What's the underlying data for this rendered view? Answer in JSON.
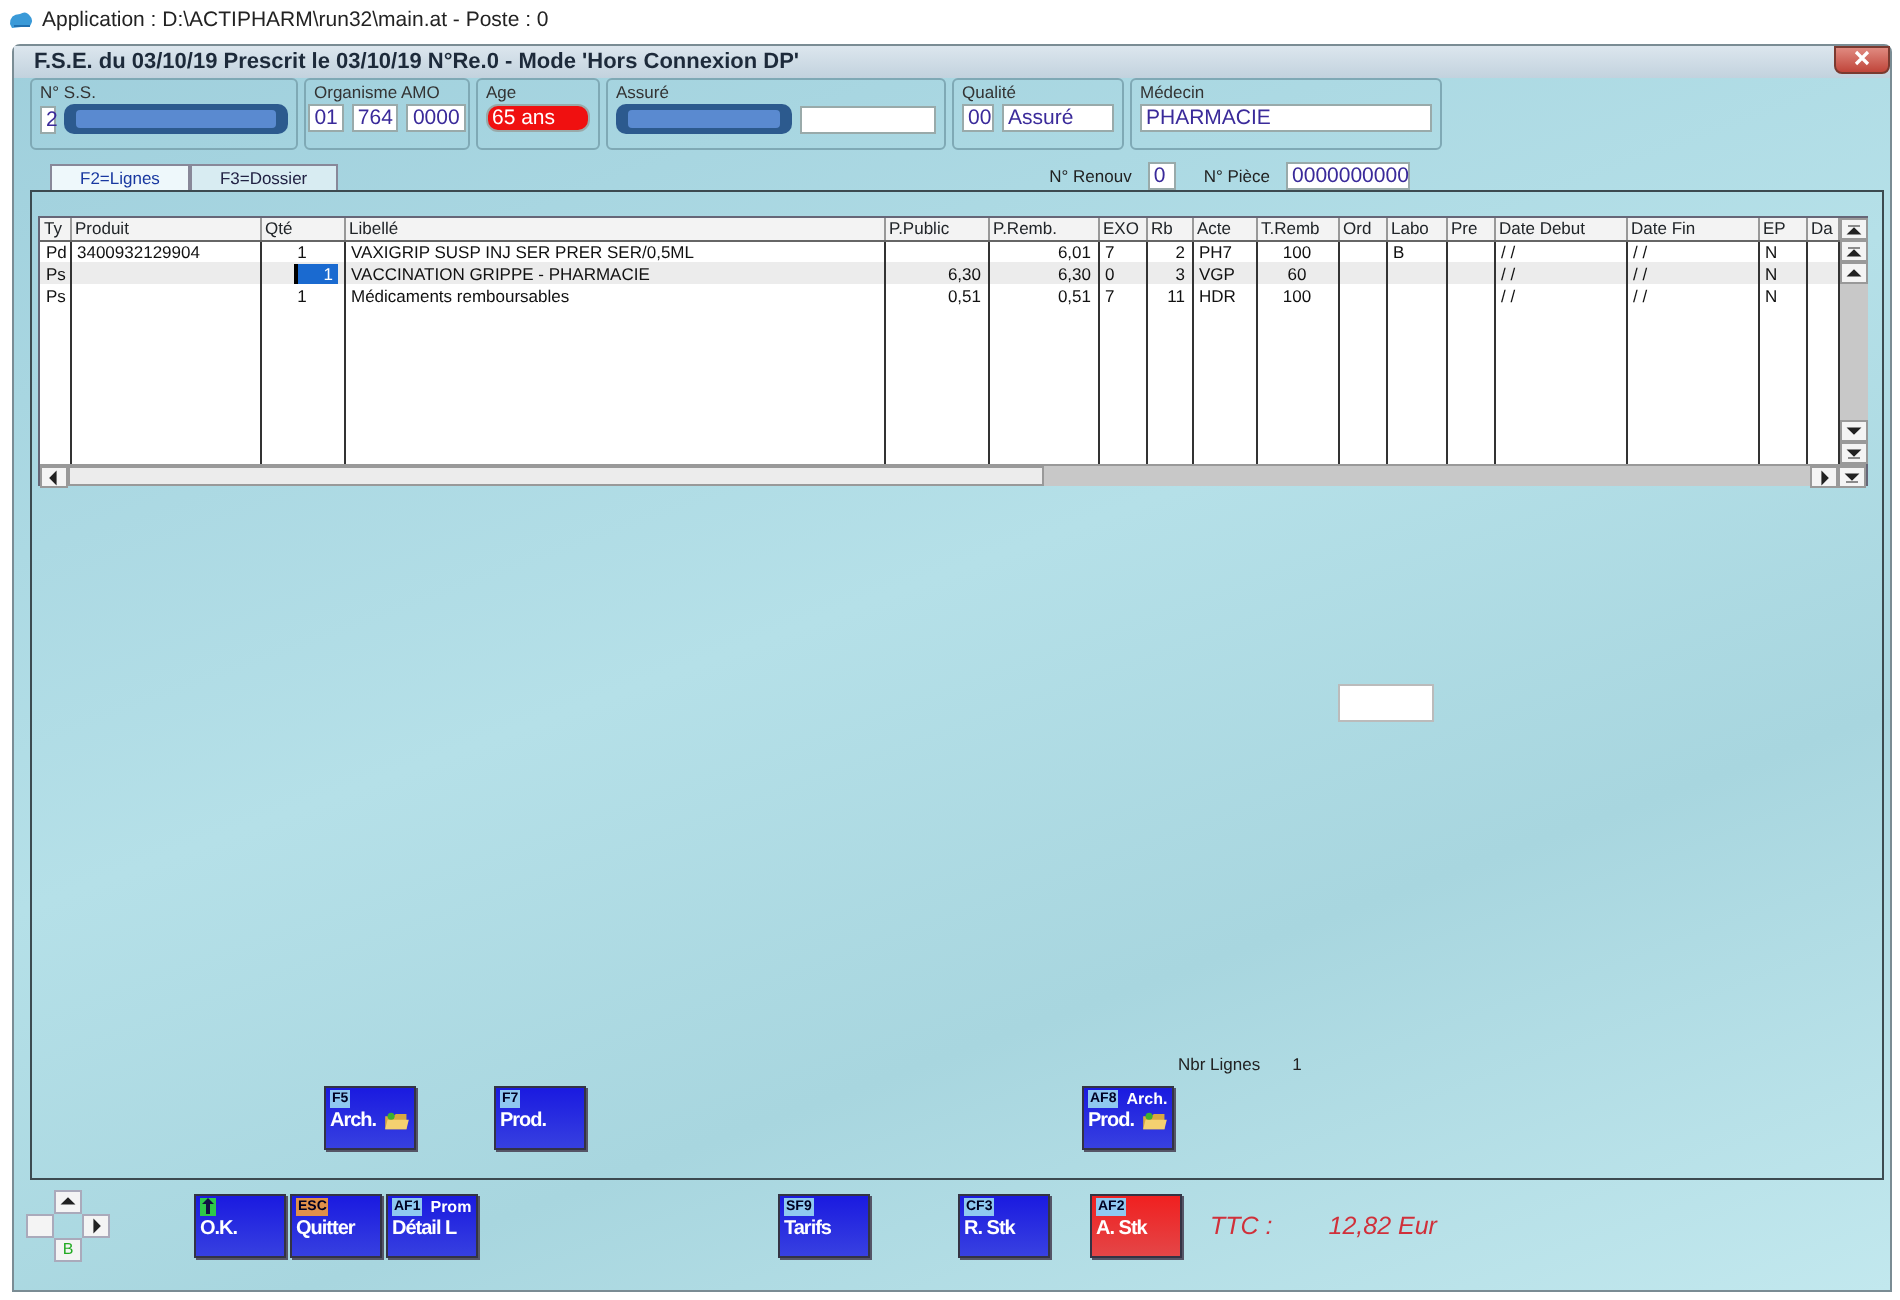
{
  "app_title": "Application : D:\\ACTIPHARM\\run32\\main.at - Poste : 0",
  "window": {
    "title": "F.S.E. du 03/10/19 Prescrit le 03/10/19 N°Re.0 - Mode 'Hors Connexion DP'"
  },
  "header": [
    {
      "label": "N° S.S.",
      "fields": [
        {
          "kind": "text",
          "value": "2"
        },
        {
          "kind": "redacted"
        }
      ]
    },
    {
      "label": "Organisme AMO",
      "fields": [
        {
          "kind": "text",
          "value": "01"
        },
        {
          "kind": "text",
          "value": "764"
        },
        {
          "kind": "text",
          "value": "0000"
        }
      ]
    },
    {
      "label": "Age",
      "fields": [
        {
          "kind": "alert",
          "value": "65 ans"
        }
      ]
    },
    {
      "label": "Assuré",
      "fields": [
        {
          "kind": "redacted"
        },
        {
          "kind": "blank"
        }
      ]
    },
    {
      "label": "Qualité",
      "fields": [
        {
          "kind": "text",
          "value": "00"
        },
        {
          "kind": "text",
          "value": "Assuré"
        }
      ]
    },
    {
      "label": "Médecin",
      "fields": [
        {
          "kind": "text",
          "value": "PHARMACIE"
        }
      ]
    }
  ],
  "tabs": [
    {
      "label": "F2=Lignes",
      "selected": true
    },
    {
      "label": "F3=Dossier",
      "selected": false
    }
  ],
  "references": [
    {
      "label": "N° Renouv",
      "value": "0"
    },
    {
      "label": "N° Pièce",
      "value": "0000000000"
    }
  ],
  "table": {
    "columns": [
      "Ty",
      "Produit",
      "Qté",
      "Libellé",
      "P.Public",
      "P.Remb.",
      "EXO",
      "Rb",
      "Acte",
      "T.Remb",
      "Ord",
      "Labo",
      "Pre",
      "Date Debut",
      "Date Fin",
      "EP",
      "Da"
    ],
    "rows": [
      {
        "selected": false,
        "cells": [
          "Pd",
          "3400932129904",
          "1",
          "VAXIGRIP SUSP INJ SER PRER SER/0,5ML",
          null,
          "6,01",
          "7",
          "2",
          "PH7",
          "100",
          null,
          "B",
          null,
          "/ /",
          "/ /",
          "N",
          null
        ]
      },
      {
        "selected": true,
        "cells": [
          "Ps",
          null,
          "1",
          "VACCINATION GRIPPE - PHARMACIE",
          "6,30",
          "6,30",
          "0",
          "3",
          "VGP",
          "60",
          null,
          null,
          null,
          "/ /",
          "/ /",
          "N",
          null
        ]
      },
      {
        "selected": false,
        "cells": [
          "Ps",
          null,
          "1",
          "Médicaments remboursables",
          "0,51",
          "0,51",
          "7",
          "11",
          "HDR",
          "100",
          null,
          null,
          null,
          "/ /",
          "/ /",
          "N",
          null
        ]
      }
    ]
  },
  "line_count": {
    "label": "Nbr Lignes",
    "value": "1"
  },
  "panel_buttons": [
    {
      "key": "F5",
      "label": "Arch.",
      "kind": "folder",
      "color": "#1a1ae0"
    },
    {
      "key": "F7",
      "label": "Prod.",
      "kind": "plain",
      "color": "#1a1ae0"
    },
    {
      "key": "AF8",
      "top_label": "Arch.",
      "label": "Prod.",
      "kind": "folder",
      "color": "#1a1ae0"
    }
  ],
  "bottom_buttons": [
    {
      "kind": "enter",
      "label": "O.K.",
      "color": "#1a1ae0"
    },
    {
      "kind": "escape",
      "key": "ESC",
      "label": "Quitter",
      "color": "#1a1ae0"
    },
    {
      "kind": "function",
      "key": "AF1",
      "top_label": "Prom",
      "label": "Détail L",
      "color": "#1a1ae0"
    },
    {
      "kind": "function",
      "key": "SF9",
      "label": "Tarifs",
      "color": "#1a1ae0"
    },
    {
      "kind": "function",
      "key": "CF3",
      "label": "R. Stk",
      "color": "#1a1ae0"
    },
    {
      "kind": "function",
      "key": "AF2",
      "label": "A. Stk",
      "color": "#f02020"
    }
  ],
  "navigator": {
    "label": "B"
  },
  "total": {
    "label": "TTC :",
    "value": "12,82 Eur"
  }
}
